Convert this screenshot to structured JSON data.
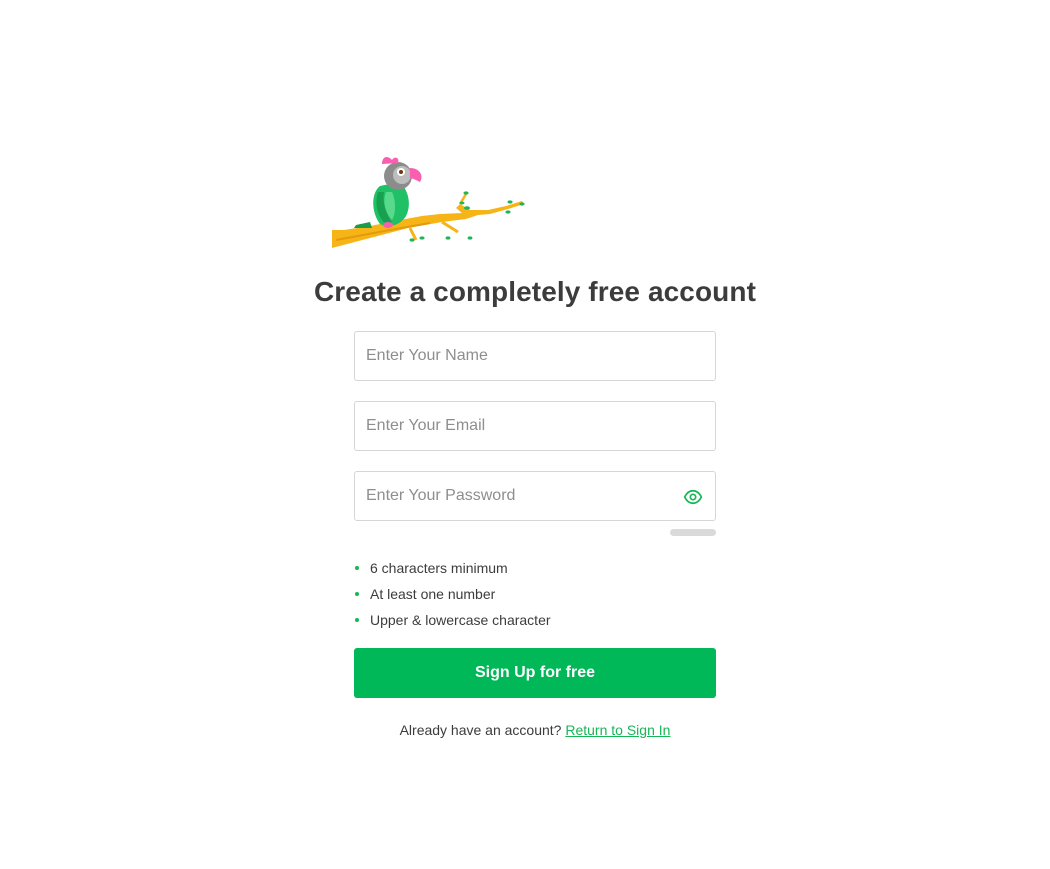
{
  "heading": "Create a completely free account",
  "form": {
    "name_placeholder": "Enter Your Name",
    "email_placeholder": "Enter Your Email",
    "password_placeholder": "Enter Your Password"
  },
  "password_rules": [
    "6 characters minimum",
    "At least one number",
    "Upper & lowercase character"
  ],
  "signup_label": "Sign Up for free",
  "footer": {
    "prompt": "Already have an account? ",
    "link_label": "Return to Sign In"
  },
  "icons": {
    "logo": "parrot-on-branch-logo",
    "password_toggle": "eye-icon"
  },
  "colors": {
    "accent": "#00b857",
    "heading": "#3c3c3c",
    "link": "#17b657"
  }
}
